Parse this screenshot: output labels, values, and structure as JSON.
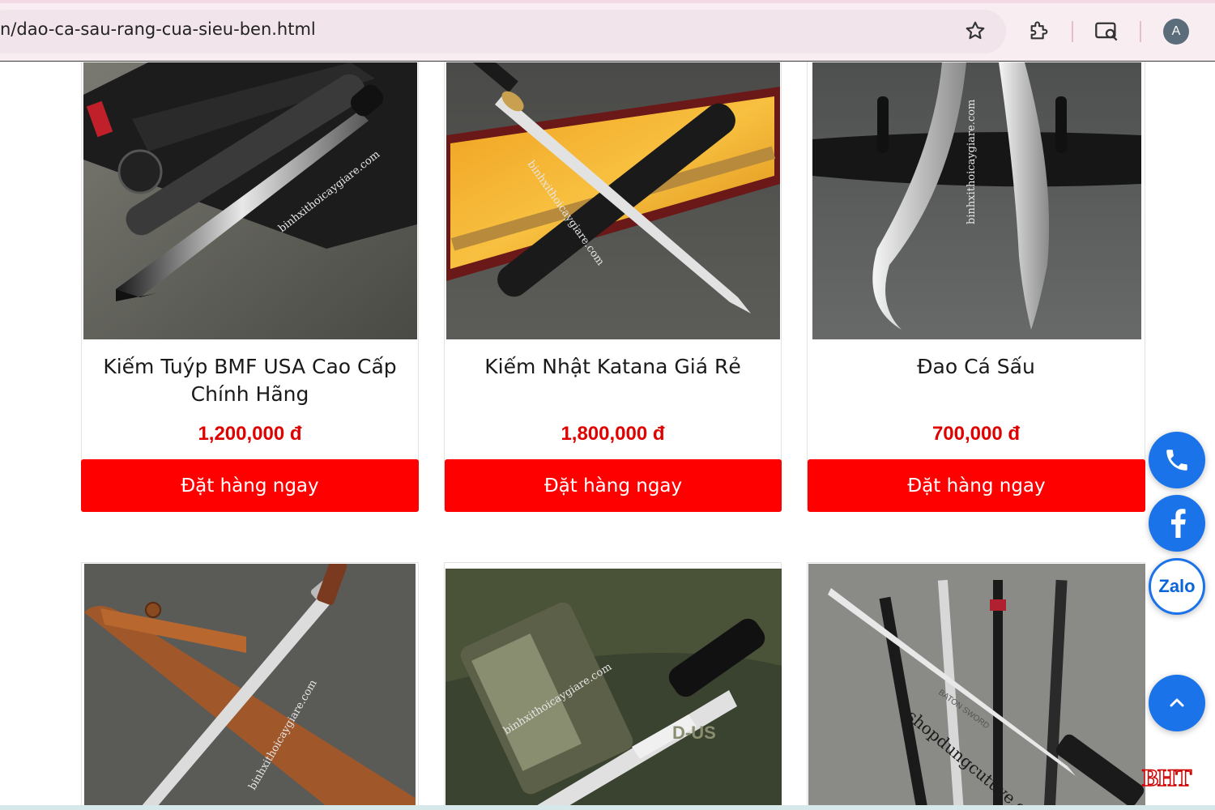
{
  "browser": {
    "url": "n/dao-ca-sau-rang-cua-sieu-ben.html",
    "icons": [
      "bookmark-star-icon",
      "extensions-icon",
      "screen-search-icon"
    ],
    "avatar_letter": "A"
  },
  "products": [
    {
      "name": "Kiếm Tuýp BMF USA Cao Cấp Chính Hãng",
      "price": "1,200,000 đ",
      "button": "Đặt hàng ngay",
      "watermark": "binhxithoicaygiare.com"
    },
    {
      "name": "Kiếm Nhật Katana Giá Rẻ",
      "price": "1,800,000 đ",
      "button": "Đặt hàng ngay",
      "watermark": "binhxithoicaygiare.com"
    },
    {
      "name": "Đao Cá Sấu",
      "price": "700,000 đ",
      "button": "Đặt hàng ngay",
      "watermark": "binhxithoicaygiare.com"
    }
  ],
  "products_row2": [
    {
      "watermark": "binhxithoicaygiare.com"
    },
    {
      "watermark": "binhxithoicaygiare.com",
      "label": "D-US"
    },
    {
      "watermark": "shopdungcutuve.com",
      "label": "BATON SWORD"
    }
  ],
  "floating": {
    "phone_icon": "phone-icon",
    "facebook_icon": "facebook-icon",
    "zalo_label": "Zalo",
    "back_to_top_icon": "chevron-up-icon"
  },
  "corner_logo": "BHT",
  "colors": {
    "accent_red": "#ff0000",
    "price_red": "#e00000",
    "float_blue": "#1a73e8"
  }
}
